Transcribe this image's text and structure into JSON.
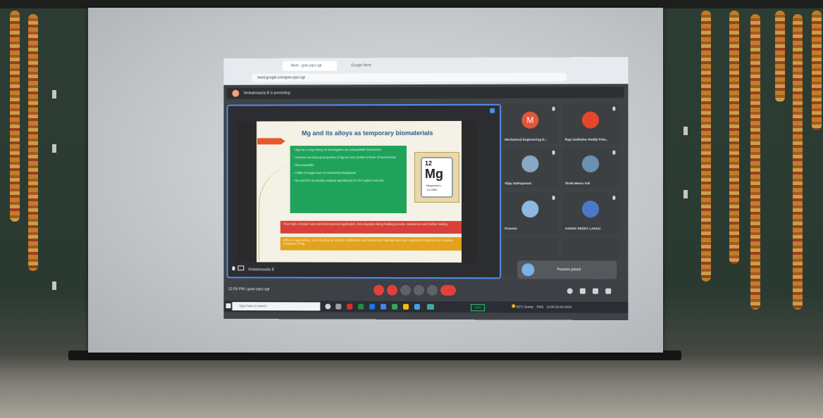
{
  "meeting": {
    "presenting_banner": "Venkateswarlu B is presenting",
    "presenter_name": "Venkateswarlu B",
    "time": "12:09 PM",
    "meeting_code": "gow-yqrs-sgr",
    "toast": "Praveen joined"
  },
  "browser": {
    "tabs": [
      "Meet - gow-yqrs-sgr",
      "Google Meet"
    ],
    "address": "meet.google.com/gow-yqrs-sgr"
  },
  "slide": {
    "title": "Mg and its alloys as temporary biomaterials",
    "bullets": [
      "• Mg has a long history of investigation as a degradable biomaterial",
      "• Inherent mechanical properties of Mg are very similar to those of human bone",
      "• Biocompatible",
      "• Ability of magnesium to harmlessly biodegrade",
      "• No need for secondary surgical operation(s) for the implant removal"
    ],
    "red_note": "Their high corrosion rates limit their practical application, they degrade during healing process, sometimes even before healing.",
    "orange_note": "Different approaches, such as alloying, surface modification, and conversion coatings have been explored to improve the corrosion resistance of Mg.",
    "element": {
      "number": "12",
      "symbol": "Mg",
      "name": "Magnesium",
      "mass": "24.3050"
    }
  },
  "participants": [
    {
      "label": "Mechanical Engineering D...",
      "initial": "M",
      "color": "#e1573a"
    },
    {
      "label": "Raja Sudhakar Reddy Pulu...",
      "initial": "",
      "color": "#e4472c"
    },
    {
      "label": "Vijay Sathupuram",
      "initial": "",
      "color": "#8aa7c4"
    },
    {
      "label": "Shaik Meera Vali",
      "initial": "",
      "color": "#6d8fb0"
    },
    {
      "label": "Praveen",
      "initial": "",
      "color": "#8fb7e0"
    },
    {
      "label": "ASHOK REDDY LAKKU",
      "initial": "",
      "color": "#4b79c9"
    }
  ],
  "taskbar": {
    "search_placeholder": "Type here to search",
    "battery": "100%",
    "weather": "33°C Sunny",
    "lang": "ENG",
    "clock_time": "12:09",
    "clock_date": "23-04-2022"
  }
}
